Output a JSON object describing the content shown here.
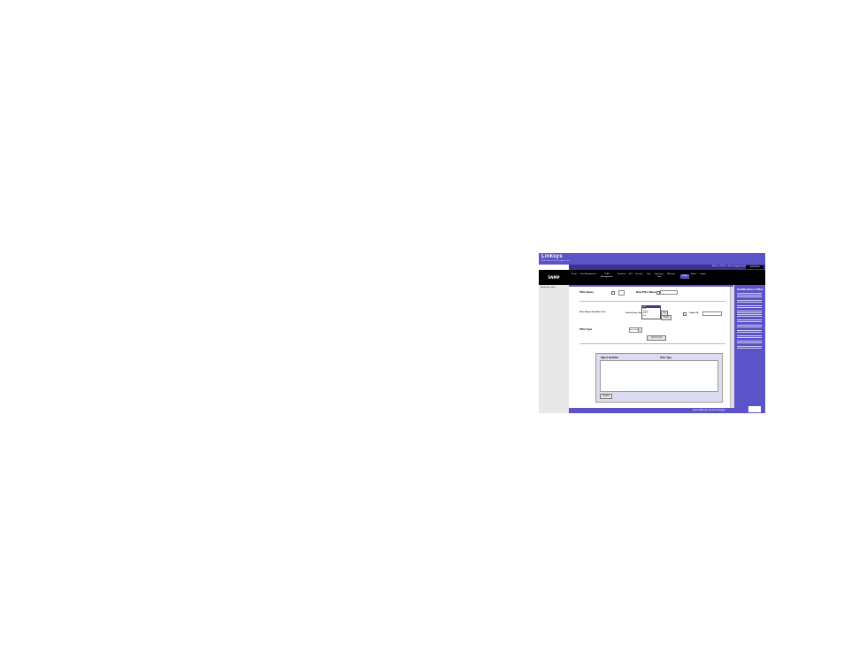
{
  "brand": {
    "logo": "Linksys",
    "tagline": "A Division of Cisco Systems, Inc."
  },
  "header": {
    "product": "48-Port 10/100 + 4-Port Gigabit Switch",
    "model": "SRW248G4"
  },
  "section_title": "SNMP",
  "tabs": [
    "Setup",
    "Port Management",
    "VLAN Management",
    "Statistics",
    "ACL",
    "Security",
    "QoS",
    "Spanning Tree",
    "Multicast",
    "SNMP",
    "Admin",
    "Logout"
  ],
  "active_tab": "SNMP",
  "left_panel": {
    "item": "Notification Filter"
  },
  "form": {
    "filter_name_label": "Filter Name",
    "new_filter_name_label": "New Filter Name",
    "new_object_identifier_tree_label": "New Object Identifier Tree",
    "select_from_list_label": "Select from List",
    "object_id_label": "Object ID",
    "filter_type_label": "Filter Type",
    "filter_type_value": "Excluded",
    "list_options": [
      "iso",
      "std",
      "mgmt",
      "mib-2",
      "priv"
    ],
    "up_button": "Up",
    "down_button": "Down",
    "add_button": "Add to List",
    "table_headers": [
      "Object Identifier",
      "Filter Type"
    ],
    "delete_button": "Delete"
  },
  "help": {
    "title": "Notification Filter"
  },
  "footer": {
    "text": "Save Settings   Cancel Changes"
  }
}
